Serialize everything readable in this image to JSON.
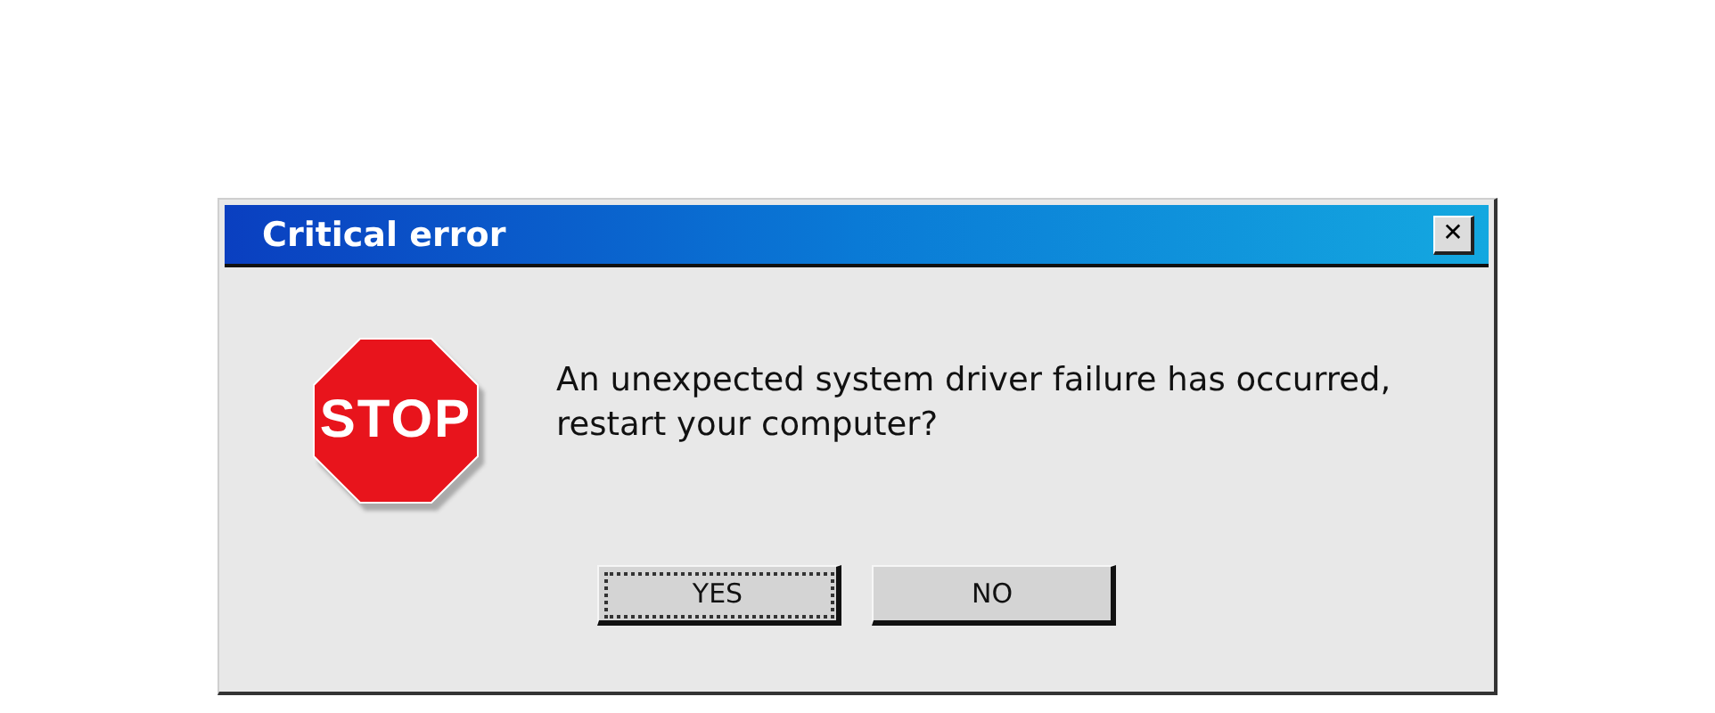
{
  "window": {
    "title": "Critical error",
    "close": "✕"
  },
  "sign": {
    "text": "STOP"
  },
  "message": {
    "lines": [
      "An unexpected system driver failure has occurred,",
      "restart your computer?"
    ]
  },
  "buttons": [
    {
      "label": "YES",
      "focused": true
    },
    {
      "label": "NO",
      "focused": false
    }
  ]
}
